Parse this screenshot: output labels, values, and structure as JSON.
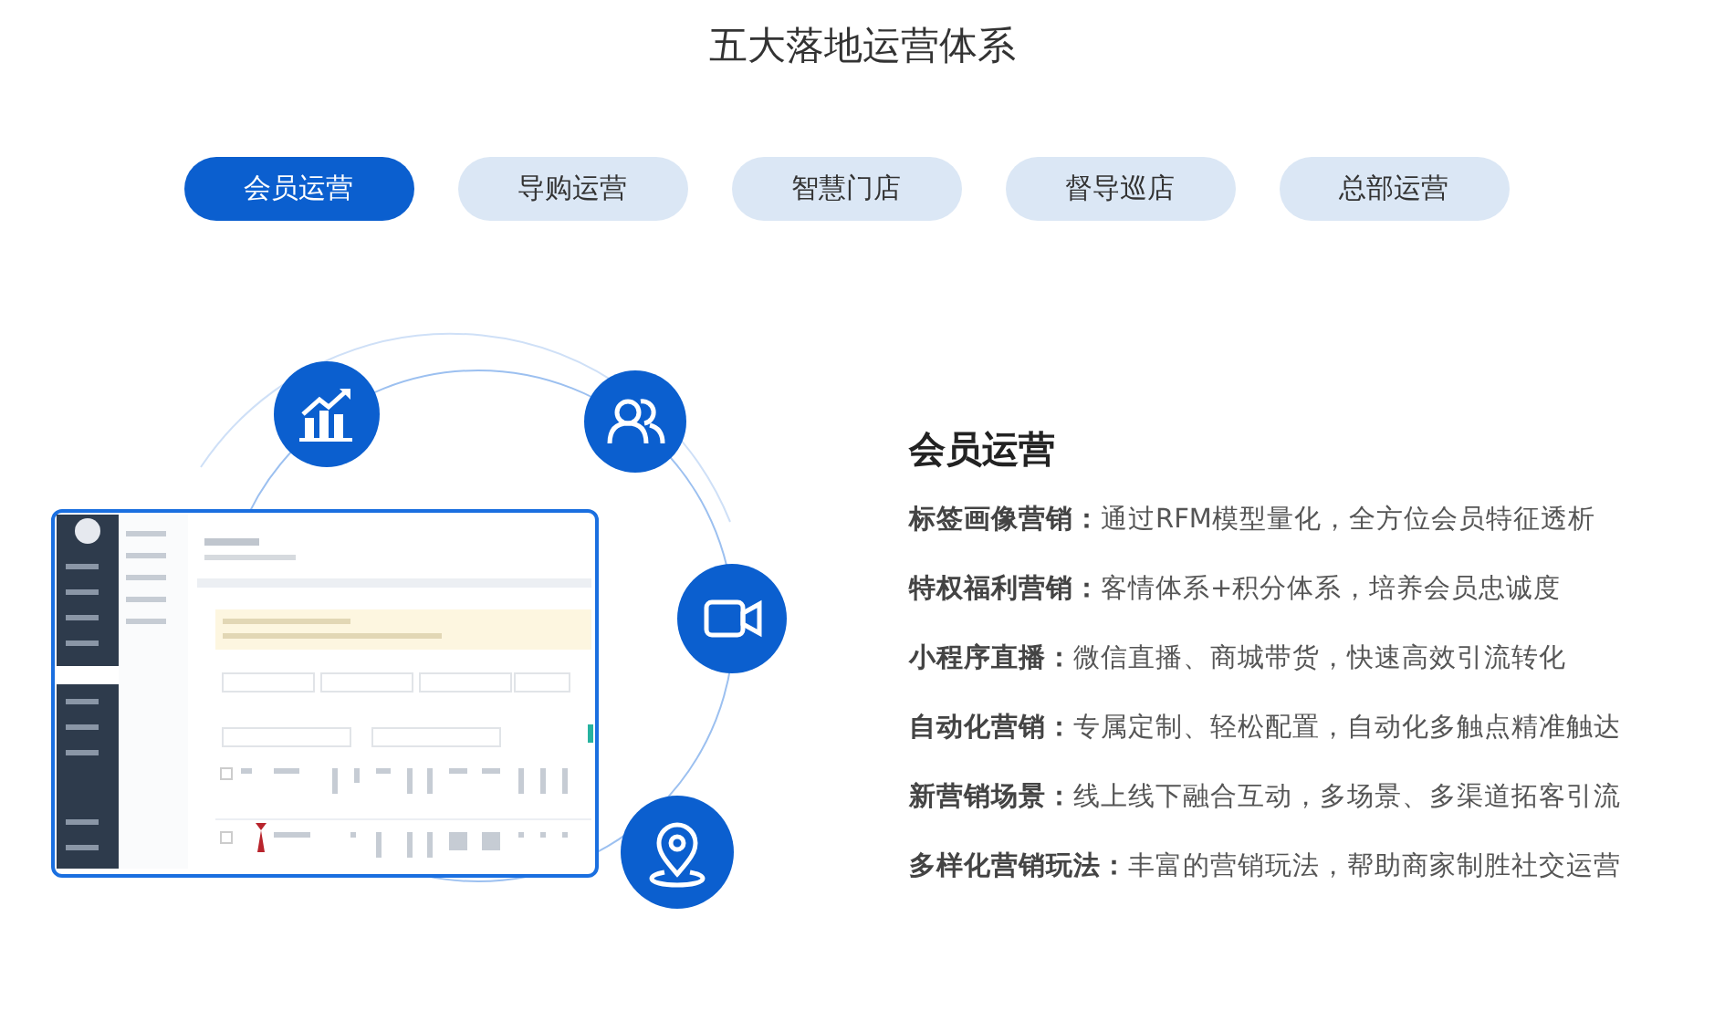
{
  "title": "五大落地运营体系",
  "tabs": [
    {
      "label": "会员运营",
      "selected": true
    },
    {
      "label": "导购运营",
      "selected": false
    },
    {
      "label": "智慧门店",
      "selected": false
    },
    {
      "label": "督导巡店",
      "selected": false
    },
    {
      "label": "总部运营",
      "selected": false
    }
  ],
  "feature": {
    "heading": "会员运营",
    "items": [
      "**标签画像营销：**通过RFM模型量化，全方位会员特征透析",
      "**特权福利营销：**客情体系+积分体系，培养会员忠诚度",
      "**小程序直播：**微信直播、商城带货，快速高效引流转化",
      "**自动化营销：**专属定制、轻松配置，自动化多触点精准触达",
      "**新营销场景：**线上线下融合互动，多场景、多渠道拓客引流",
      "**多样化营销玩法：**丰富的营销玩法，帮助商家制胜社交运营"
    ]
  }
}
